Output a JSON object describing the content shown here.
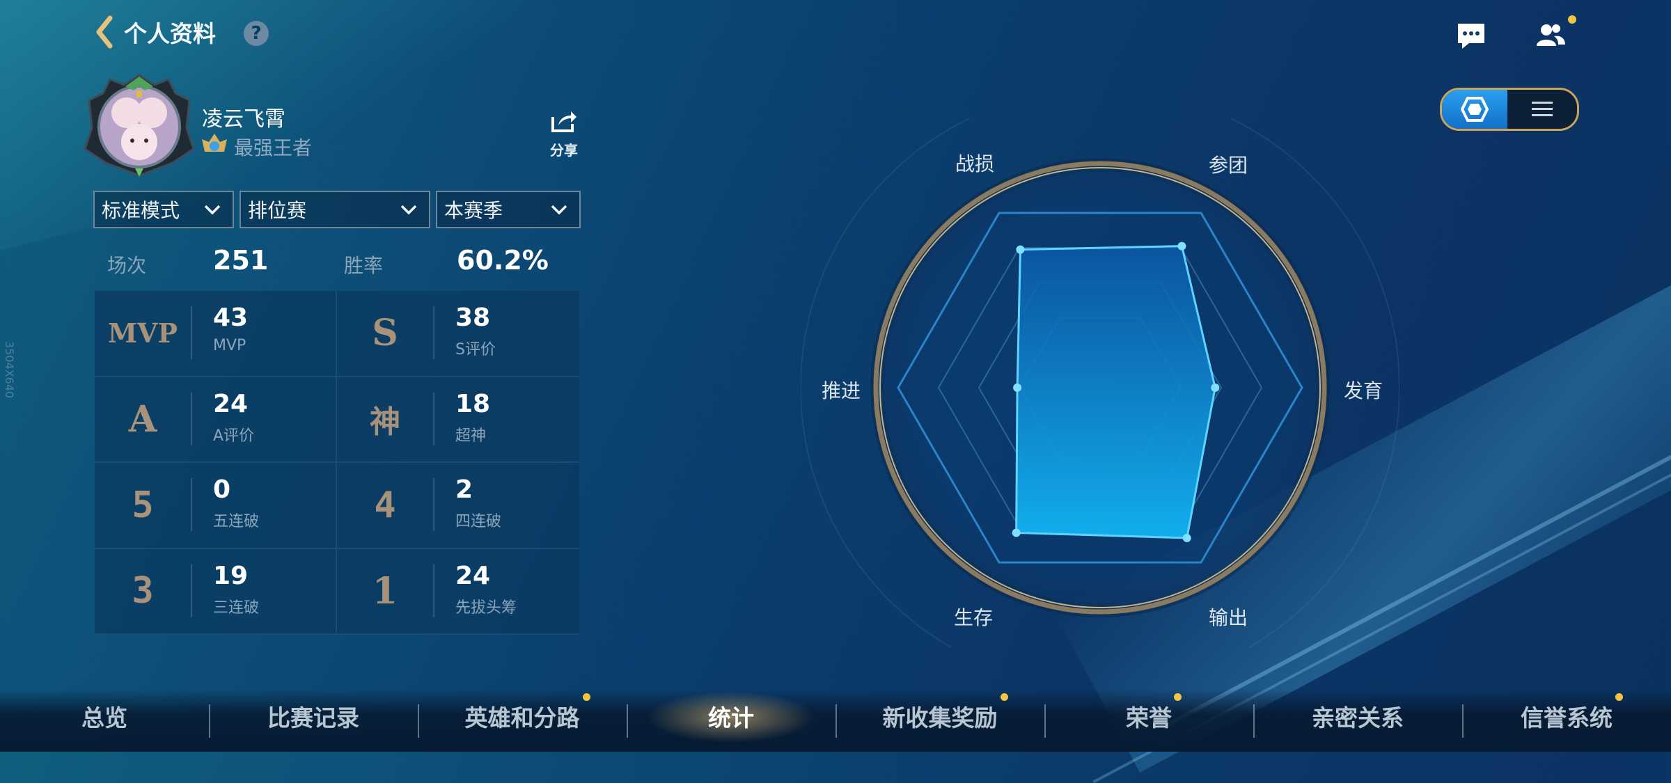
{
  "header": {
    "title": "个人资料",
    "help": "?"
  },
  "profile": {
    "username": "凌云飞霄",
    "rank": "最强王者",
    "share_label": "分享"
  },
  "filters": [
    {
      "label": "标准模式"
    },
    {
      "label": "排位赛"
    },
    {
      "label": "本赛季"
    }
  ],
  "summary": {
    "matches_label": "场次",
    "matches_value": "251",
    "winrate_label": "胜率",
    "winrate_value": "60.2%"
  },
  "stats": [
    {
      "glyph": "MVP",
      "value": "43",
      "label": "MVP"
    },
    {
      "glyph": "S",
      "value": "38",
      "label": "S评价"
    },
    {
      "glyph": "A",
      "value": "24",
      "label": "A评价"
    },
    {
      "glyph": "神",
      "value": "18",
      "label": "超神"
    },
    {
      "glyph": "5",
      "value": "0",
      "label": "五连破"
    },
    {
      "glyph": "4",
      "value": "2",
      "label": "四连破"
    },
    {
      "glyph": "3",
      "value": "19",
      "label": "三连破"
    },
    {
      "glyph": "1",
      "value": "24",
      "label": "先拔头筹"
    }
  ],
  "radar": {
    "axes": [
      "战损",
      "参团",
      "发育",
      "输出",
      "生存",
      "推进"
    ],
    "values": [
      0.79,
      0.81,
      0.57,
      0.86,
      0.83,
      0.41
    ]
  },
  "nav": {
    "tabs": [
      {
        "label": "总览",
        "active": false,
        "dot": false
      },
      {
        "label": "比赛记录",
        "active": false,
        "dot": false
      },
      {
        "label": "英雄和分路",
        "active": false,
        "dot": true
      },
      {
        "label": "统计",
        "active": true,
        "dot": false
      },
      {
        "label": "新收集奖励",
        "active": false,
        "dot": true
      },
      {
        "label": "荣誉",
        "active": false,
        "dot": true
      },
      {
        "label": "亲密关系",
        "active": false,
        "dot": false
      },
      {
        "label": "信誉系统",
        "active": false,
        "dot": true
      }
    ]
  },
  "watermark": "3504X640",
  "icons": {
    "back": "chevron-left-icon",
    "help": "question-icon",
    "chat": "chat-icon",
    "friends": "friends-icon",
    "share": "share-icon",
    "view_radar": "hexagon-icon",
    "view_list": "list-icon",
    "rank": "rank-emblem-icon"
  },
  "colors": {
    "accent": "#2a9ff0",
    "gold": "#c9a45a",
    "radar_fill": "#1aa8f0",
    "notify_dot": "#f5c542"
  }
}
